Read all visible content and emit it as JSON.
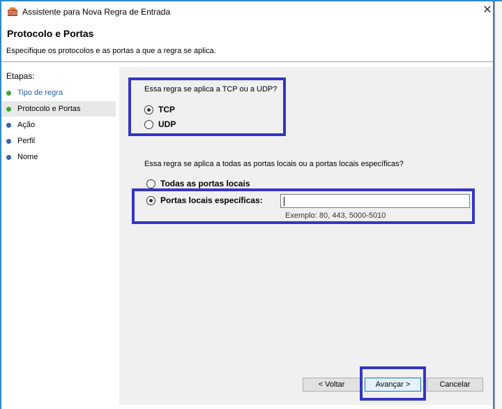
{
  "window": {
    "title": "Assistente para Nova Regra de Entrada",
    "close_glyph": "✕"
  },
  "header": {
    "title": "Protocolo e Portas",
    "subtitle": "Especifique os protocolos e as portas a que a regra se aplica."
  },
  "steps": {
    "title": "Etapas:",
    "items": [
      {
        "label": "Tipo de regra",
        "state": "done",
        "color": "#1f5fa8"
      },
      {
        "label": "Protocolo e Portas",
        "state": "current",
        "color": "#000000"
      },
      {
        "label": "Ação",
        "state": "pending",
        "color": "#000000"
      },
      {
        "label": "Perfil",
        "state": "pending",
        "color": "#000000"
      },
      {
        "label": "Nome",
        "state": "pending",
        "color": "#000000"
      }
    ]
  },
  "protocol": {
    "question": "Essa regra se aplica a TCP ou a UDP?",
    "options": [
      {
        "label": "TCP",
        "selected": true
      },
      {
        "label": "UDP",
        "selected": false
      }
    ]
  },
  "ports": {
    "question": "Essa regra se aplica a todas as portas locais ou a portas locais específicas?",
    "all_label": "Todas as portas locais",
    "specific_label": "Portas locais específicas:",
    "specific_value": "",
    "example": "Exemplo: 80, 443, 5000-5010"
  },
  "buttons": {
    "back": "< Voltar",
    "next": "Avançar >",
    "cancel": "Cancelar"
  },
  "colors": {
    "highlight": "#3535c8",
    "done_dot": "#3aa83a",
    "pending_dot": "#3a5fb8"
  }
}
